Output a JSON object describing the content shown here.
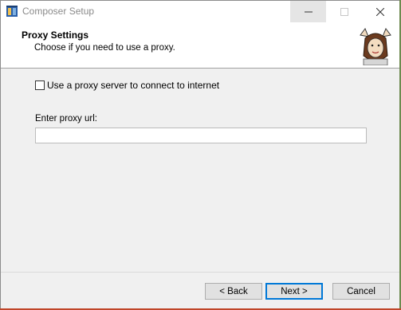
{
  "window": {
    "title": "Composer Setup"
  },
  "controls": {
    "minimize_icon": "minimize-icon",
    "maximize_icon": "maximize-icon",
    "close_icon": "close-icon"
  },
  "header": {
    "title": "Proxy Settings",
    "subtitle": "Choose if you need to use a proxy."
  },
  "proxy": {
    "checkbox_label": "Use a proxy server to connect to internet",
    "checkbox_checked": false,
    "url_label": "Enter proxy url:",
    "url_value": ""
  },
  "buttons": {
    "back": "< Back",
    "next": "Next >",
    "cancel": "Cancel"
  },
  "colors": {
    "accent": "#0078d7",
    "dialog_bg": "#f0f0f0"
  }
}
